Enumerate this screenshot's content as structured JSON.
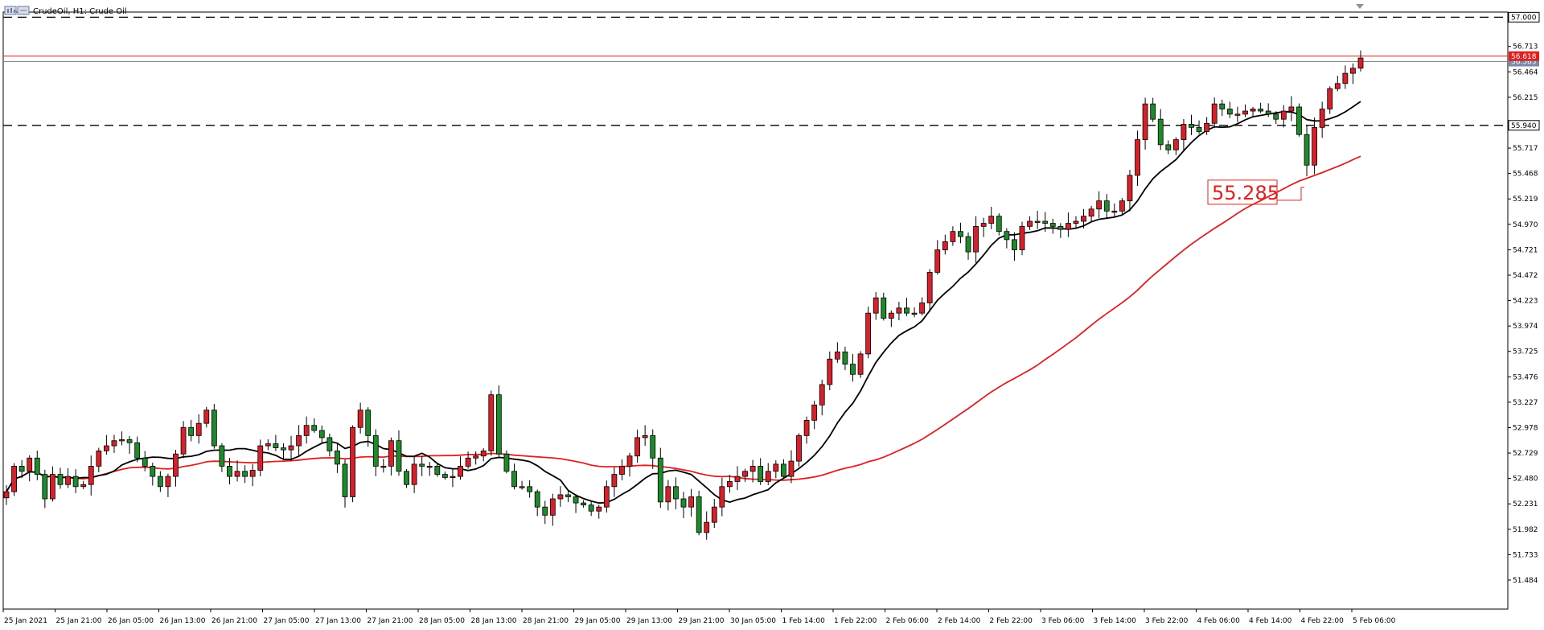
{
  "window": {
    "title": "CrudeOil, H1:  Crude Oil"
  },
  "colors": {
    "background": "#ffffff",
    "bull_body": "#d8202a",
    "bear_body": "#1e8a2c",
    "wick": "#000000",
    "sma_fast": "#000000",
    "sma_slow": "#e02020",
    "annotation": "#e02020",
    "resistance_line": "#e02020",
    "dashed_levels": "#000000"
  },
  "chart_data": {
    "type": "candlestick",
    "symbol": "CrudeOil",
    "timeframe": "H1",
    "ylim": [
      51.2,
      57.05
    ],
    "yticks": [
      "56.713",
      "56.464",
      "56.215",
      "55.717",
      "55.468",
      "55.219",
      "54.970",
      "54.721",
      "54.472",
      "54.223",
      "53.974",
      "53.725",
      "53.476",
      "53.227",
      "52.978",
      "52.729",
      "52.480",
      "52.231",
      "51.982",
      "51.733",
      "51.484"
    ],
    "xticks": [
      "25 Jan 2021",
      "25 Jan 21:00",
      "26 Jan 05:00",
      "26 Jan 13:00",
      "26 Jan 21:00",
      "27 Jan 05:00",
      "27 Jan 13:00",
      "27 Jan 21:00",
      "28 Jan 05:00",
      "28 Jan 13:00",
      "28 Jan 21:00",
      "29 Jan 05:00",
      "29 Jan 13:00",
      "29 Jan 21:00",
      "30 Jan 05:00",
      "1 Feb 14:00",
      "1 Feb 22:00",
      "2 Feb 06:00",
      "2 Feb 14:00",
      "2 Feb 22:00",
      "3 Feb 06:00",
      "3 Feb 14:00",
      "3 Feb 22:00",
      "4 Feb 06:00",
      "4 Feb 14:00",
      "4 Feb 22:00",
      "5 Feb 06:00"
    ],
    "levels": [
      {
        "label": "57.000",
        "value": 57.0,
        "style": "dashed"
      },
      {
        "label": "55.940",
        "value": 55.94,
        "style": "dashed"
      },
      {
        "label": "56.565",
        "value": 56.565,
        "style": "solid-red"
      },
      {
        "label": "56.618",
        "value": 56.618,
        "style": "solid-red"
      }
    ],
    "annotation": {
      "label": "55.285",
      "value": 55.285
    },
    "closes": [
      52.35,
      52.6,
      52.55,
      52.68,
      52.52,
      52.28,
      52.52,
      52.42,
      52.5,
      52.4,
      52.42,
      52.6,
      52.75,
      52.8,
      52.85,
      52.86,
      52.83,
      52.68,
      52.6,
      52.5,
      52.4,
      52.5,
      52.72,
      52.98,
      52.9,
      53.02,
      53.15,
      52.8,
      52.6,
      52.5,
      52.55,
      52.5,
      52.56,
      52.8,
      52.82,
      52.78,
      52.76,
      52.8,
      52.9,
      53.0,
      52.95,
      52.88,
      52.75,
      52.62,
      52.3,
      52.98,
      53.15,
      52.9,
      52.6,
      52.6,
      52.85,
      52.55,
      52.42,
      52.62,
      52.6,
      52.6,
      52.52,
      52.49,
      52.5,
      52.6,
      52.68,
      52.7,
      52.75,
      53.3,
      52.72,
      52.55,
      52.4,
      52.4,
      52.35,
      52.2,
      52.12,
      52.28,
      52.32,
      52.3,
      52.24,
      52.22,
      52.16,
      52.2,
      52.4,
      52.52,
      52.6,
      52.7,
      52.88,
      52.9,
      52.68,
      52.25,
      52.4,
      52.28,
      52.2,
      52.3,
      51.95,
      52.05,
      52.2,
      52.4,
      52.45,
      52.5,
      52.55,
      52.6,
      52.45,
      52.55,
      52.62,
      52.5,
      52.65,
      52.9,
      53.05,
      53.2,
      53.4,
      53.65,
      53.72,
      53.6,
      53.5,
      53.7,
      54.1,
      54.25,
      54.05,
      54.1,
      54.15,
      54.1,
      54.1,
      54.2,
      54.5,
      54.72,
      54.8,
      54.9,
      54.85,
      54.7,
      54.95,
      54.98,
      55.05,
      54.9,
      54.82,
      54.72,
      54.95,
      55.0,
      55.0,
      54.98,
      54.95,
      54.92,
      54.98,
      55.0,
      55.05,
      55.12,
      55.2,
      55.1,
      55.1,
      55.2,
      55.45,
      55.8,
      56.15,
      56.0,
      55.75,
      55.7,
      55.8,
      55.95,
      55.92,
      55.88,
      55.96,
      56.15,
      56.1,
      56.05,
      56.05,
      56.08,
      56.1,
      56.08,
      56.05,
      56.0,
      56.08,
      56.12,
      55.85,
      55.55,
      55.92,
      56.1,
      56.3,
      56.35,
      56.45,
      56.5,
      56.6
    ]
  }
}
